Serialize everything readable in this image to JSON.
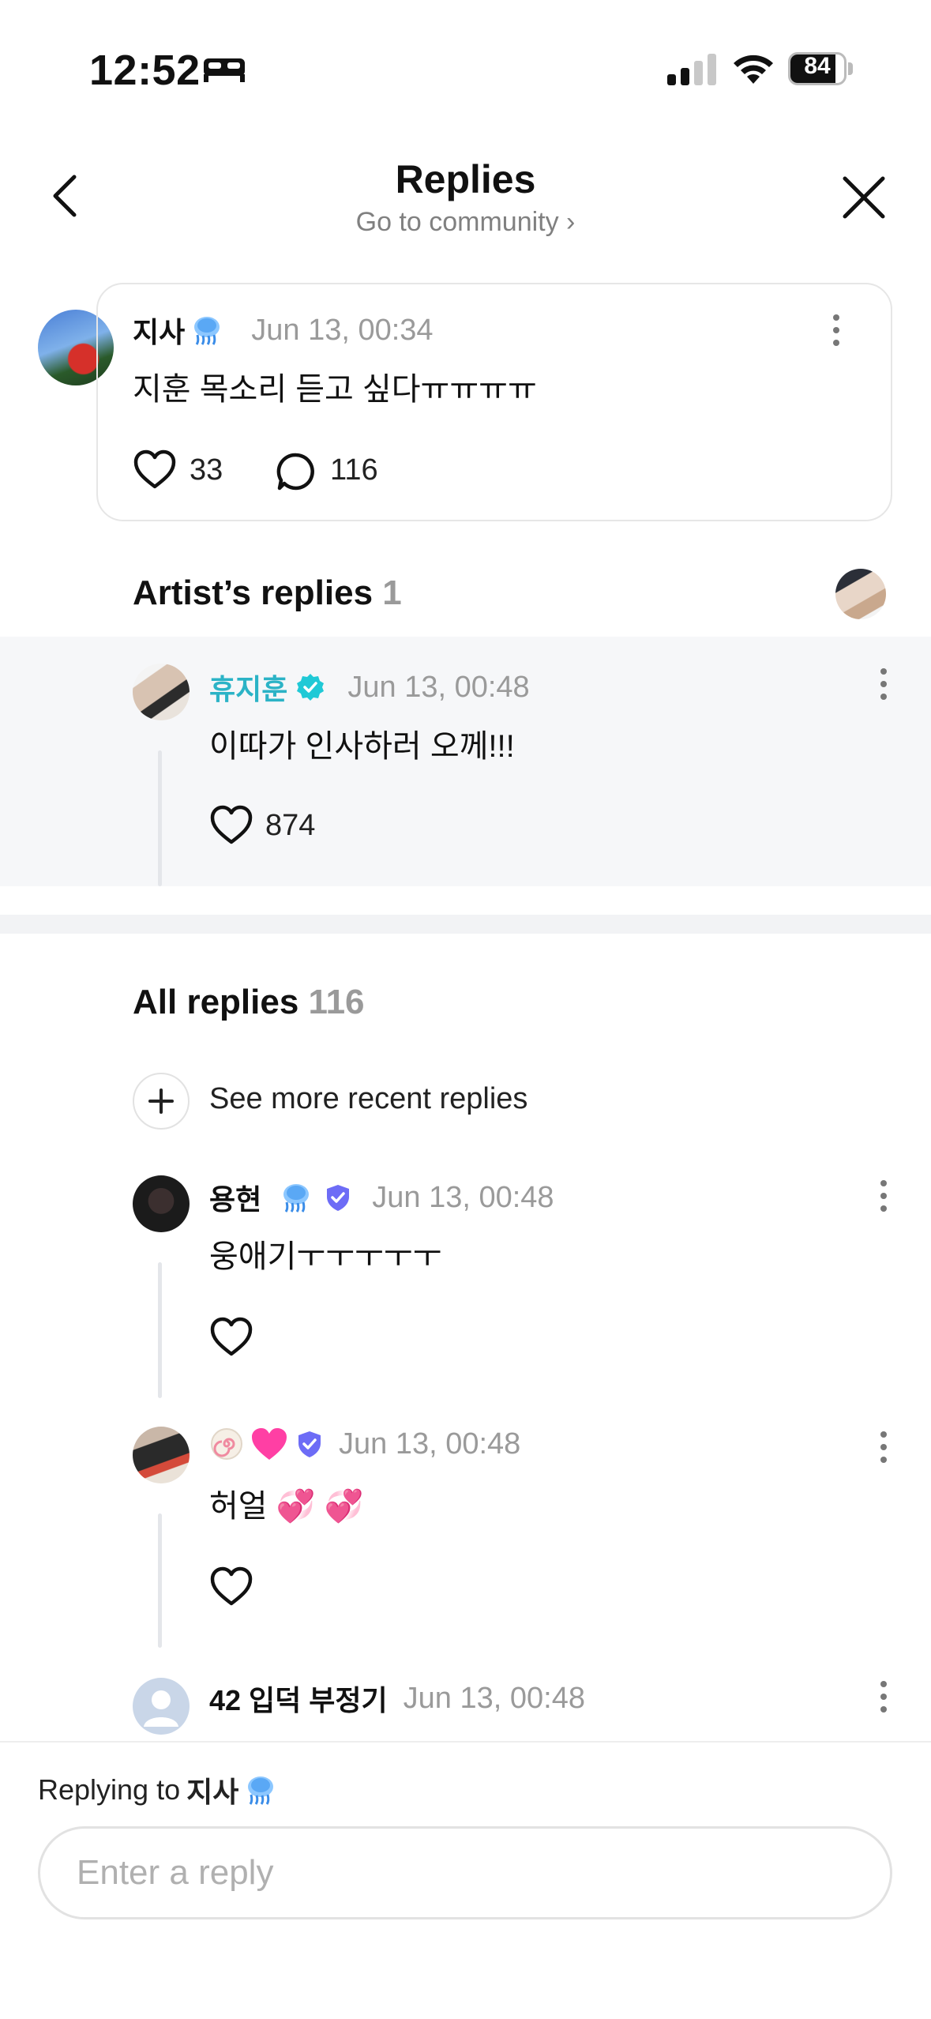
{
  "status_bar": {
    "time": "12:52",
    "battery": "84",
    "battery_level": 0.84
  },
  "header": {
    "title": "Replies",
    "subtitle": "Go to community ›"
  },
  "post": {
    "author": "지사",
    "date": "Jun 13, 00:34",
    "text": "지훈 목소리 듣고 싶다ㅠㅠㅠㅠ",
    "likes": "33",
    "comments": "116"
  },
  "artist_section": {
    "title": "Artist’s replies",
    "count": "1"
  },
  "artist_reply": {
    "author": "휴지훈",
    "date": "Jun 13, 00:48",
    "text": "이따가 인사하러 오께!!!",
    "likes": "874"
  },
  "all_section": {
    "title": "All replies",
    "count": "116",
    "see_more": "See more recent replies"
  },
  "replies": [
    {
      "author": "용현",
      "date": "Jun 13, 00:48",
      "text": "웅애기ㅜㅜㅜㅜㅜ"
    },
    {
      "author": "",
      "date": "Jun 13, 00:48",
      "text": "허얼 💞 💞"
    },
    {
      "author": "42 입덕 부정기",
      "date": "Jun 13, 00:48"
    }
  ],
  "composer": {
    "replying_prefix": "Replying to",
    "replying_name": "지사",
    "placeholder": "Enter a reply"
  },
  "colors": {
    "artist_name": "#2bb3c6",
    "verified_teal": "#20c9d6",
    "verified_violet": "#6d6cf6",
    "pink_heart": "#ff3fa4"
  }
}
